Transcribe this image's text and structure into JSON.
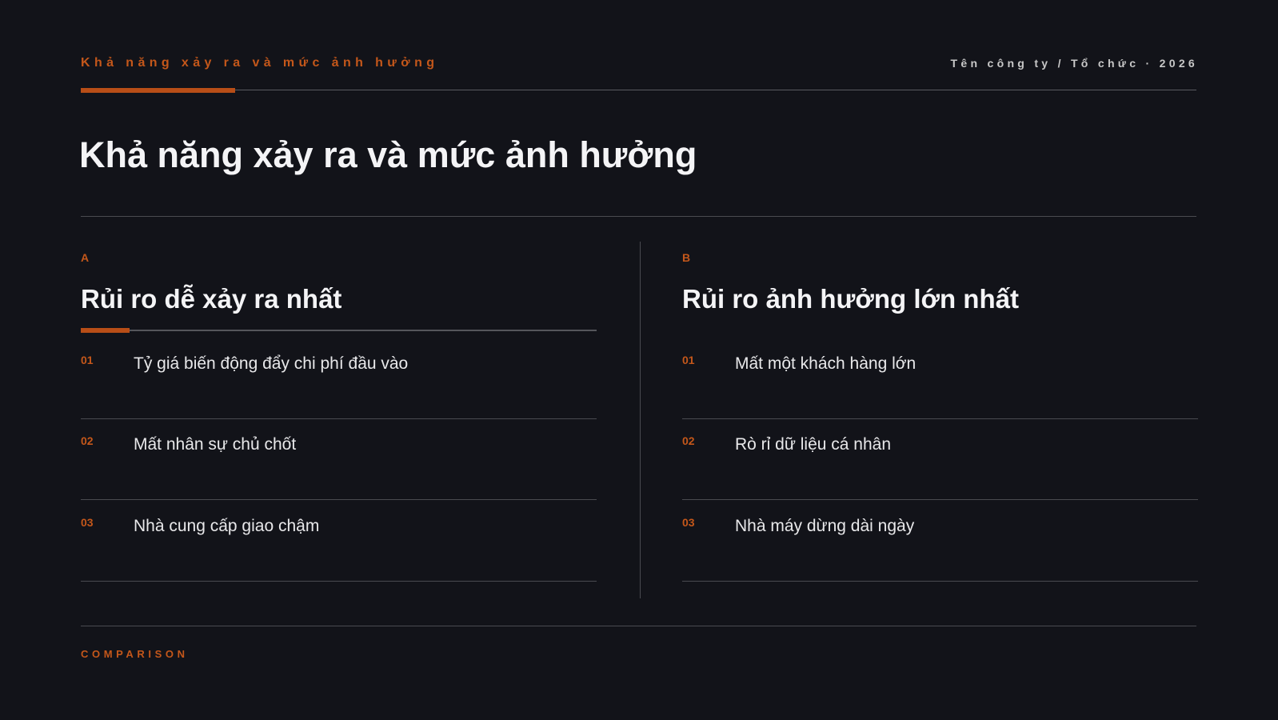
{
  "header": {
    "kicker": "Khả năng xảy ra và mức ảnh hưởng",
    "organization": "Tên công ty / Tổ chức · 2026"
  },
  "title": "Khả năng xảy ra và mức ảnh hưởng",
  "columns": [
    {
      "letter": "A",
      "heading": "Rủi ro dễ xảy ra nhất",
      "items": [
        {
          "number": "01",
          "text": "Tỷ giá biến động đẩy chi phí đầu vào"
        },
        {
          "number": "02",
          "text": "Mất nhân sự chủ chốt"
        },
        {
          "number": "03",
          "text": "Nhà cung cấp giao chậm"
        }
      ]
    },
    {
      "letter": "B",
      "heading": "Rủi ro ảnh hưởng lớn nhất",
      "items": [
        {
          "number": "01",
          "text": "Mất một khách hàng lớn"
        },
        {
          "number": "02",
          "text": "Rò rỉ dữ liệu cá nhân"
        },
        {
          "number": "03",
          "text": "Nhà máy dừng dài ngày"
        }
      ]
    }
  ],
  "footer": {
    "label": "COMPARISON"
  },
  "colors": {
    "background": "#121319",
    "accent": "#c4571a",
    "text": "#f4f4f6",
    "rule": "#4a4b50"
  }
}
